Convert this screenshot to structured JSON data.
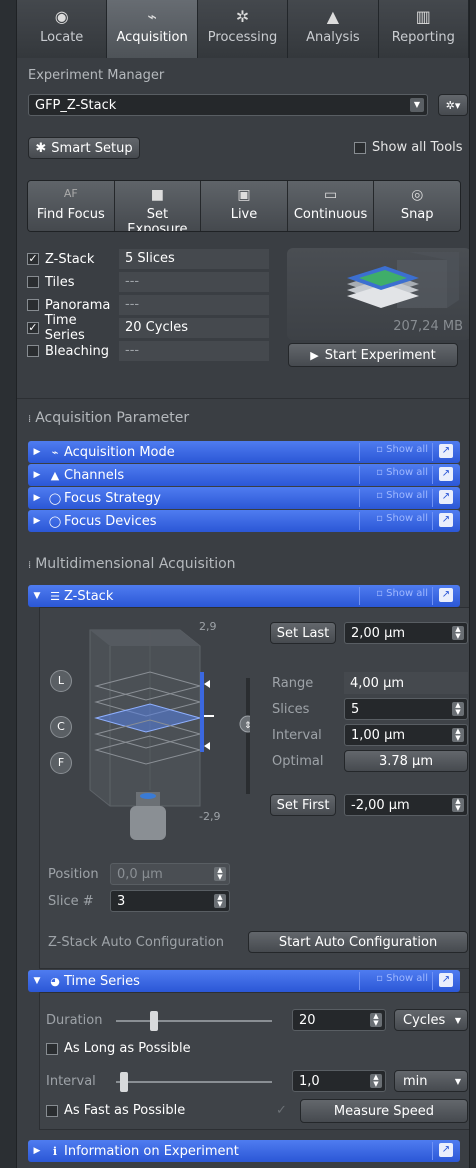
{
  "tabs": [
    {
      "label": "Locate",
      "icon": "locate-icon"
    },
    {
      "label": "Acquisition",
      "icon": "acquisition-icon",
      "active": true
    },
    {
      "label": "Processing",
      "icon": "processing-icon"
    },
    {
      "label": "Analysis",
      "icon": "analysis-icon"
    },
    {
      "label": "Reporting",
      "icon": "reporting-icon"
    }
  ],
  "experiment_manager": {
    "label": "Experiment Manager",
    "selected": "GFP_Z-Stack"
  },
  "smart_setup": "Smart Setup",
  "show_all_tools": "Show all Tools",
  "toolbar": [
    {
      "label": "Find Focus",
      "icon_text": "AF"
    },
    {
      "label": "Set Exposure",
      "icon": "camera-icon"
    },
    {
      "label": "Live",
      "icon": "live-icon"
    },
    {
      "label": "Continuous",
      "icon": "continuous-icon"
    },
    {
      "label": "Snap",
      "icon": "snap-icon"
    }
  ],
  "dimensions": [
    {
      "label": "Z-Stack",
      "checked": true,
      "value": "5 Slices"
    },
    {
      "label": "Tiles",
      "checked": false,
      "value": "---"
    },
    {
      "label": "Panorama",
      "checked": false,
      "value": "---"
    },
    {
      "label": "Time Series",
      "checked": true,
      "value": "20 Cycles"
    },
    {
      "label": "Bleaching",
      "checked": false,
      "value": "---"
    }
  ],
  "preview_size": "207,24 MB",
  "start_experiment": "Start Experiment",
  "acq_param_header": "Acquisition Parameter",
  "acq_bars": [
    {
      "label": "Acquisition Mode",
      "show_all": "Show all"
    },
    {
      "label": "Channels",
      "show_all": "Show all"
    },
    {
      "label": "Focus Strategy",
      "show_all": "Show all"
    },
    {
      "label": "Focus Devices",
      "show_all": "Show all"
    }
  ],
  "multidim_header": "Multidimensional Acquisition",
  "zstack": {
    "title": "Z-Stack",
    "show_all": "Show all",
    "top_tick": "2,9",
    "bottom_tick": "-2,9",
    "markers": [
      "L",
      "C",
      "F"
    ],
    "set_last_label": "Set Last",
    "set_last_value": "2,00 µm",
    "range_label": "Range",
    "range_value": "4,00 µm",
    "slices_label": "Slices",
    "slices_value": "5",
    "interval_label": "Interval",
    "interval_value": "1,00 µm",
    "optimal_label": "Optimal",
    "optimal_value": "3.78 µm",
    "set_first_label": "Set First",
    "set_first_value": "-2,00 µm",
    "position_label": "Position",
    "position_value": "0,0 µm",
    "slice_label": "Slice #",
    "slice_value": "3",
    "auto_config_label": "Z-Stack Auto Configuration",
    "auto_config_button": "Start Auto Configuration"
  },
  "timeseries": {
    "title": "Time Series",
    "show_all": "Show all",
    "duration_label": "Duration",
    "duration_value": "20",
    "duration_unit": "Cycles",
    "as_long_label": "As Long as Possible",
    "interval_label": "Interval",
    "interval_value": "1,0",
    "interval_unit": "min",
    "as_fast_label": "As Fast as Possible",
    "measure_speed": "Measure Speed"
  },
  "info_bar": "Information on Experiment",
  "colors": {
    "accent_blue": "#2b57d6",
    "panel_bg": "#3a3e43"
  }
}
